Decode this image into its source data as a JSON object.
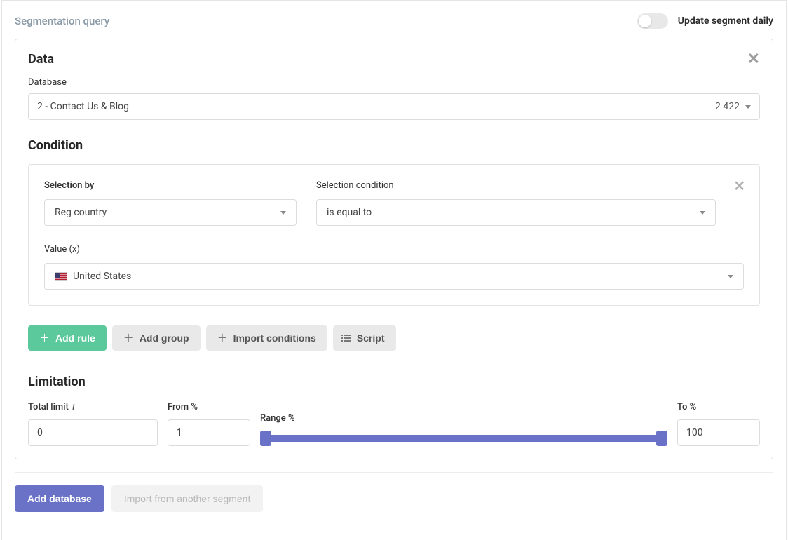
{
  "header": {
    "title": "Segmentation query",
    "update_toggle_label": "Update segment daily",
    "update_toggle_on": false
  },
  "data_section": {
    "title": "Data",
    "database_label": "Database",
    "database_value": "2 - Contact Us & Blog",
    "database_count": "2 422"
  },
  "condition_section": {
    "title": "Condition",
    "selection_by_label": "Selection by",
    "selection_by_value": "Reg country",
    "selection_condition_label": "Selection condition",
    "selection_condition_value": "is equal to",
    "value_label": "Value (x)",
    "value_value": "United States"
  },
  "buttons": {
    "add_rule": "Add rule",
    "add_group": "Add group",
    "import_conditions": "Import conditions",
    "script": "Script"
  },
  "limitation_section": {
    "title": "Limitation",
    "total_limit_label": "Total limit",
    "total_limit_value": "0",
    "from_pct_label": "From %",
    "from_pct_value": "1",
    "range_pct_label": "Range %",
    "to_pct_label": "To %",
    "to_pct_value": "100"
  },
  "footer": {
    "add_database": "Add database",
    "import_segment": "Import from another segment"
  }
}
